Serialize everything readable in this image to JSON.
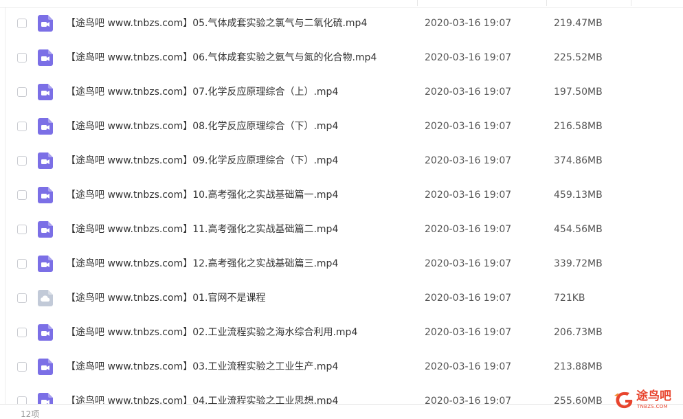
{
  "files": [
    {
      "name": "【途鸟吧 www.tnbzs.com】05.气体成套实验之氯气与二氧化硫.mp4",
      "date": "2020-03-16 19:07",
      "size": "219.47MB",
      "icon": "video-file-icon"
    },
    {
      "name": "【途鸟吧 www.tnbzs.com】06.气体成套实验之氨气与氮的化合物.mp4",
      "date": "2020-03-16 19:07",
      "size": "225.52MB",
      "icon": "video-file-icon"
    },
    {
      "name": "【途鸟吧 www.tnbzs.com】07.化学反应原理综合（上）.mp4",
      "date": "2020-03-16 19:07",
      "size": "197.50MB",
      "icon": "video-file-icon"
    },
    {
      "name": "【途鸟吧 www.tnbzs.com】08.化学反应原理综合（下）.mp4",
      "date": "2020-03-16 19:07",
      "size": "216.58MB",
      "icon": "video-file-icon"
    },
    {
      "name": "【途鸟吧 www.tnbzs.com】09.化学反应原理综合（下）.mp4",
      "date": "2020-03-16 19:07",
      "size": "374.86MB",
      "icon": "video-file-icon"
    },
    {
      "name": "【途鸟吧 www.tnbzs.com】10.高考强化之实战基础篇一.mp4",
      "date": "2020-03-16 19:07",
      "size": "459.13MB",
      "icon": "video-file-icon"
    },
    {
      "name": "【途鸟吧 www.tnbzs.com】11.高考强化之实战基础篇二.mp4",
      "date": "2020-03-16 19:07",
      "size": "454.56MB",
      "icon": "video-file-icon"
    },
    {
      "name": "【途鸟吧 www.tnbzs.com】12.高考强化之实战基础篇三.mp4",
      "date": "2020-03-16 19:07",
      "size": "339.72MB",
      "icon": "video-file-icon"
    },
    {
      "name": "【途鸟吧 www.tnbzs.com】01.官网不是课程",
      "date": "2020-03-16 19:07",
      "size": "721KB",
      "icon": "cloud-file-icon"
    },
    {
      "name": "【途鸟吧 www.tnbzs.com】02.工业流程实验之海水综合利用.mp4",
      "date": "2020-03-16 19:07",
      "size": "206.73MB",
      "icon": "video-file-icon"
    },
    {
      "name": "【途鸟吧 www.tnbzs.com】03.工业流程实验之工业生产.mp4",
      "date": "2020-03-16 19:07",
      "size": "213.88MB",
      "icon": "video-file-icon"
    },
    {
      "name": "【途鸟吧 www.tnbzs.com】04.工业流程实验之工业思想.mp4",
      "date": "2020-03-16 19:07",
      "size": "255.60MB",
      "icon": "video-file-icon"
    }
  ],
  "footer": {
    "count": "12项"
  },
  "watermark": {
    "text": "途鸟吧",
    "url": "TNBZS.COM",
    "logo_icon": "tnbzs-logo-icon"
  },
  "colors": {
    "video_icon": "#7b6fe6",
    "cloud_icon": "#c2cad8",
    "watermark": "#e8452e"
  }
}
